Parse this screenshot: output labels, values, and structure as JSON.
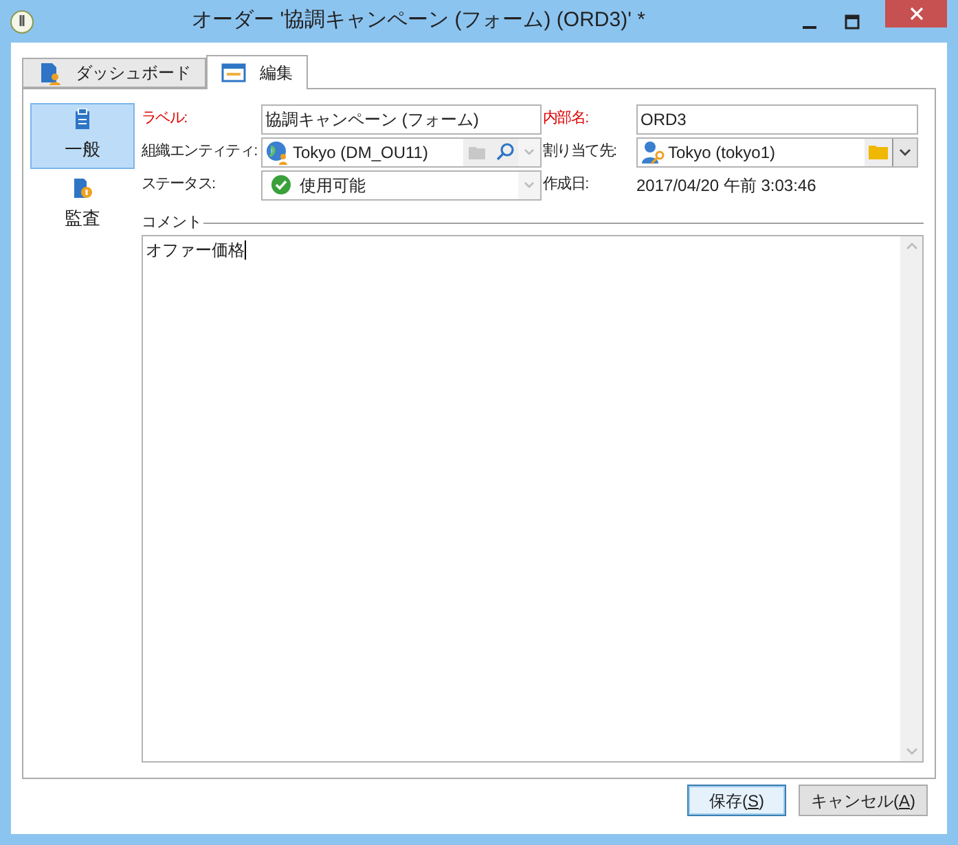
{
  "window": {
    "title": "オーダー '協調キャンペーン (フォーム) (ORD3)' *"
  },
  "tabs": [
    {
      "label": "ダッシュボード",
      "selected": false
    },
    {
      "label": "編集",
      "selected": true
    }
  ],
  "sidebar": {
    "items": [
      {
        "label": "一般",
        "selected": true
      },
      {
        "label": "監査",
        "selected": false
      }
    ]
  },
  "form": {
    "label": {
      "caption": "ラベル:",
      "required": true,
      "value": "協調キャンペーン (フォーム)"
    },
    "internal_name": {
      "caption": "内部名:",
      "required": true,
      "value": "ORD3"
    },
    "org_entity": {
      "caption": "組織エンティティ:",
      "value": "Tokyo (DM_OU11)"
    },
    "assignee": {
      "caption": "割り当て先:",
      "value": "Tokyo (tokyo1)"
    },
    "status": {
      "caption": "ステータス:",
      "value": "使用可能"
    },
    "created": {
      "caption": "作成日:",
      "value": "2017/04/20 午前 3:03:46"
    },
    "comment": {
      "caption": "コメント",
      "value": "オファー価格"
    }
  },
  "buttons": [
    {
      "before": "保存(",
      "key": "S",
      "after": ")",
      "default": true
    },
    {
      "before": "キャンセル(",
      "key": "A",
      "after": ")",
      "default": false
    }
  ]
}
